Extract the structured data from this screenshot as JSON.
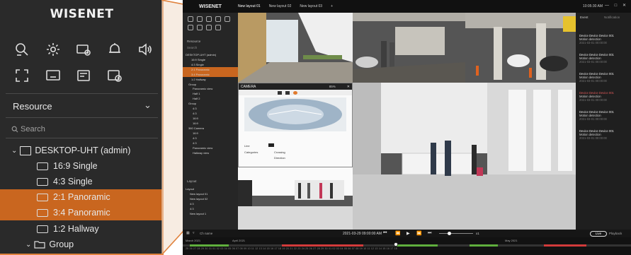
{
  "zoom": {
    "logo": "WISENET",
    "resource_title": "Resource",
    "search_placeholder": "Search",
    "tree": [
      {
        "label": "DESKTOP-UHT (admin)",
        "level": 0,
        "type": "pc"
      },
      {
        "label": "16:9 Single",
        "level": 2,
        "type": "layout"
      },
      {
        "label": "4:3 Single",
        "level": 2,
        "type": "layout"
      },
      {
        "label": "2:1 Panoramic",
        "level": 2,
        "type": "layout",
        "selected": true
      },
      {
        "label": "3:4 Panoramic",
        "level": 2,
        "type": "layout",
        "selected": true
      },
      {
        "label": "1:2 Hallway",
        "level": 2,
        "type": "layout"
      },
      {
        "label": "Group",
        "level": 1,
        "type": "folder"
      }
    ],
    "colors": {
      "accent": "#c9661f",
      "bg": "#2a2a2a",
      "border": "#e0823d"
    }
  },
  "app": {
    "brand": "WISENET",
    "tabs": [
      "New layout 01",
      "New layout 02",
      "New layout 03"
    ],
    "add_tab": "+",
    "clock": "10:05:30 AM",
    "window_controls": "— □ ✕",
    "resource_label": "Resource",
    "search_label": "Search",
    "tree_rows": [
      {
        "label": "DESKTOP-UHT (admin)"
      },
      {
        "label": "16:9 Single"
      },
      {
        "label": "4:3 Single"
      },
      {
        "label": "2:1 Panoramic",
        "selected": true
      },
      {
        "label": "3:4 Panoramic",
        "selected": true
      },
      {
        "label": "1:2 Hallway"
      },
      {
        "label": "Group"
      },
      {
        "label": "Panoramic view"
      },
      {
        "label": "Half 1"
      },
      {
        "label": "Half 2"
      },
      {
        "label": "Group"
      },
      {
        "label": "4:3"
      },
      {
        "label": "4:3"
      },
      {
        "label": "16:9"
      },
      {
        "label": "16:9"
      },
      {
        "label": "360 Camera"
      },
      {
        "label": "16:9"
      },
      {
        "label": "4:3"
      },
      {
        "label": "4:3"
      },
      {
        "label": "Panoramic view"
      },
      {
        "label": "Hallway view"
      }
    ],
    "layout_label": "Layout",
    "layout_rows": [
      {
        "label": "Layout"
      },
      {
        "label": "New layout 01"
      },
      {
        "label": "New layout 02"
      },
      {
        "label": "4:3"
      },
      {
        "label": "4:3"
      },
      {
        "label": "New layout 1"
      }
    ],
    "camera_dialog": {
      "title": "CAMERA",
      "zoom": "85%",
      "fields": [
        "Line",
        "Categories"
      ],
      "options": [
        "Crossing",
        "Direction"
      ]
    },
    "right_panel": {
      "tabs": [
        "Event",
        "Notification"
      ],
      "events": [
        {
          "title": "Device Device Device 001",
          "detail": "Motion detection",
          "time": "2021-03-01 00:00:00",
          "red": false
        },
        {
          "title": "Device Device Device 001",
          "detail": "Motion detection",
          "time": "2021-03-01 00:00:00",
          "red": false
        },
        {
          "title": "Device Device Device 001",
          "detail": "Motion detection",
          "time": "2021-03-01 00:00:00",
          "red": false
        },
        {
          "title": "Device Device Device 001",
          "detail": "Motion detection",
          "time": "2021-03-01 00:00:00",
          "red": true
        },
        {
          "title": "Device Device Device 001",
          "detail": "Motion detection",
          "time": "2021-03-01 00:00:00",
          "red": false
        },
        {
          "title": "Device Device Device 001",
          "detail": "Motion detection",
          "time": "2021-03-01 00:00:00",
          "red": false
        }
      ]
    },
    "controls": {
      "search_label": "Ch name",
      "datetime": "2021-03-29 09:00:00 AM",
      "speed": "x1",
      "live_label": "Live",
      "playback_label": "Playback"
    },
    "timeline": {
      "months": [
        "March 2021",
        "April 2021",
        "May 2021"
      ],
      "days": "25 26 27 28 29 30 31 01 02 03 04 05 06 07 08 09 10 11 12 13 14 15 16 17 18 19 20 21 22 23 24 25 26 27 28 29 30 01 02 03 04 05 06 07 08 09 10 11 12 13 14 15 16 17 18"
    }
  }
}
